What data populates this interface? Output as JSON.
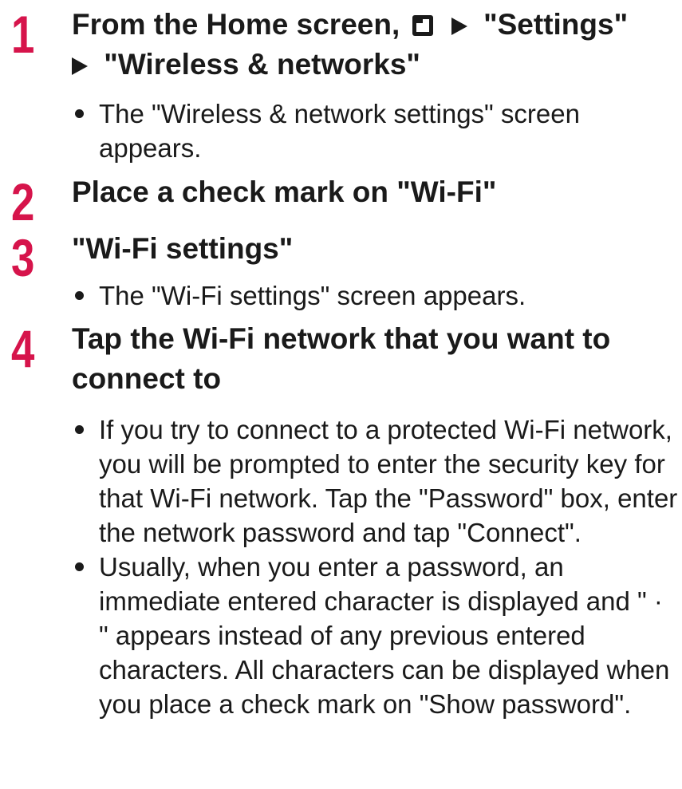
{
  "accent_color": "#d6144b",
  "steps": [
    {
      "number": "1",
      "title_part1": "From the Home screen,",
      "icon": "menu-icon",
      "title_part2": "\"Settings\"",
      "title_part3": "\"Wireless & networks\"",
      "notes": [
        "The \"Wireless & network settings\" screen appears."
      ]
    },
    {
      "number": "2",
      "title": "Place a check mark on \"Wi-Fi\"",
      "notes": []
    },
    {
      "number": "3",
      "title": "\"Wi-Fi settings\"",
      "notes": [
        "The \"Wi-Fi settings\" screen appears."
      ]
    },
    {
      "number": "4",
      "title": "Tap the Wi-Fi network that you want to connect to",
      "notes": [
        "If you try to connect to a protected Wi-Fi network, you will be prompted to enter the security key for that Wi-Fi network. Tap the \"Password\" box, enter the network password and tap \"Connect\".",
        "Usually, when you enter a password, an immediate entered character is displayed and \" · \" appears instead of any previous entered characters. All characters can be displayed when you place a check mark on \"Show password\"."
      ]
    }
  ]
}
